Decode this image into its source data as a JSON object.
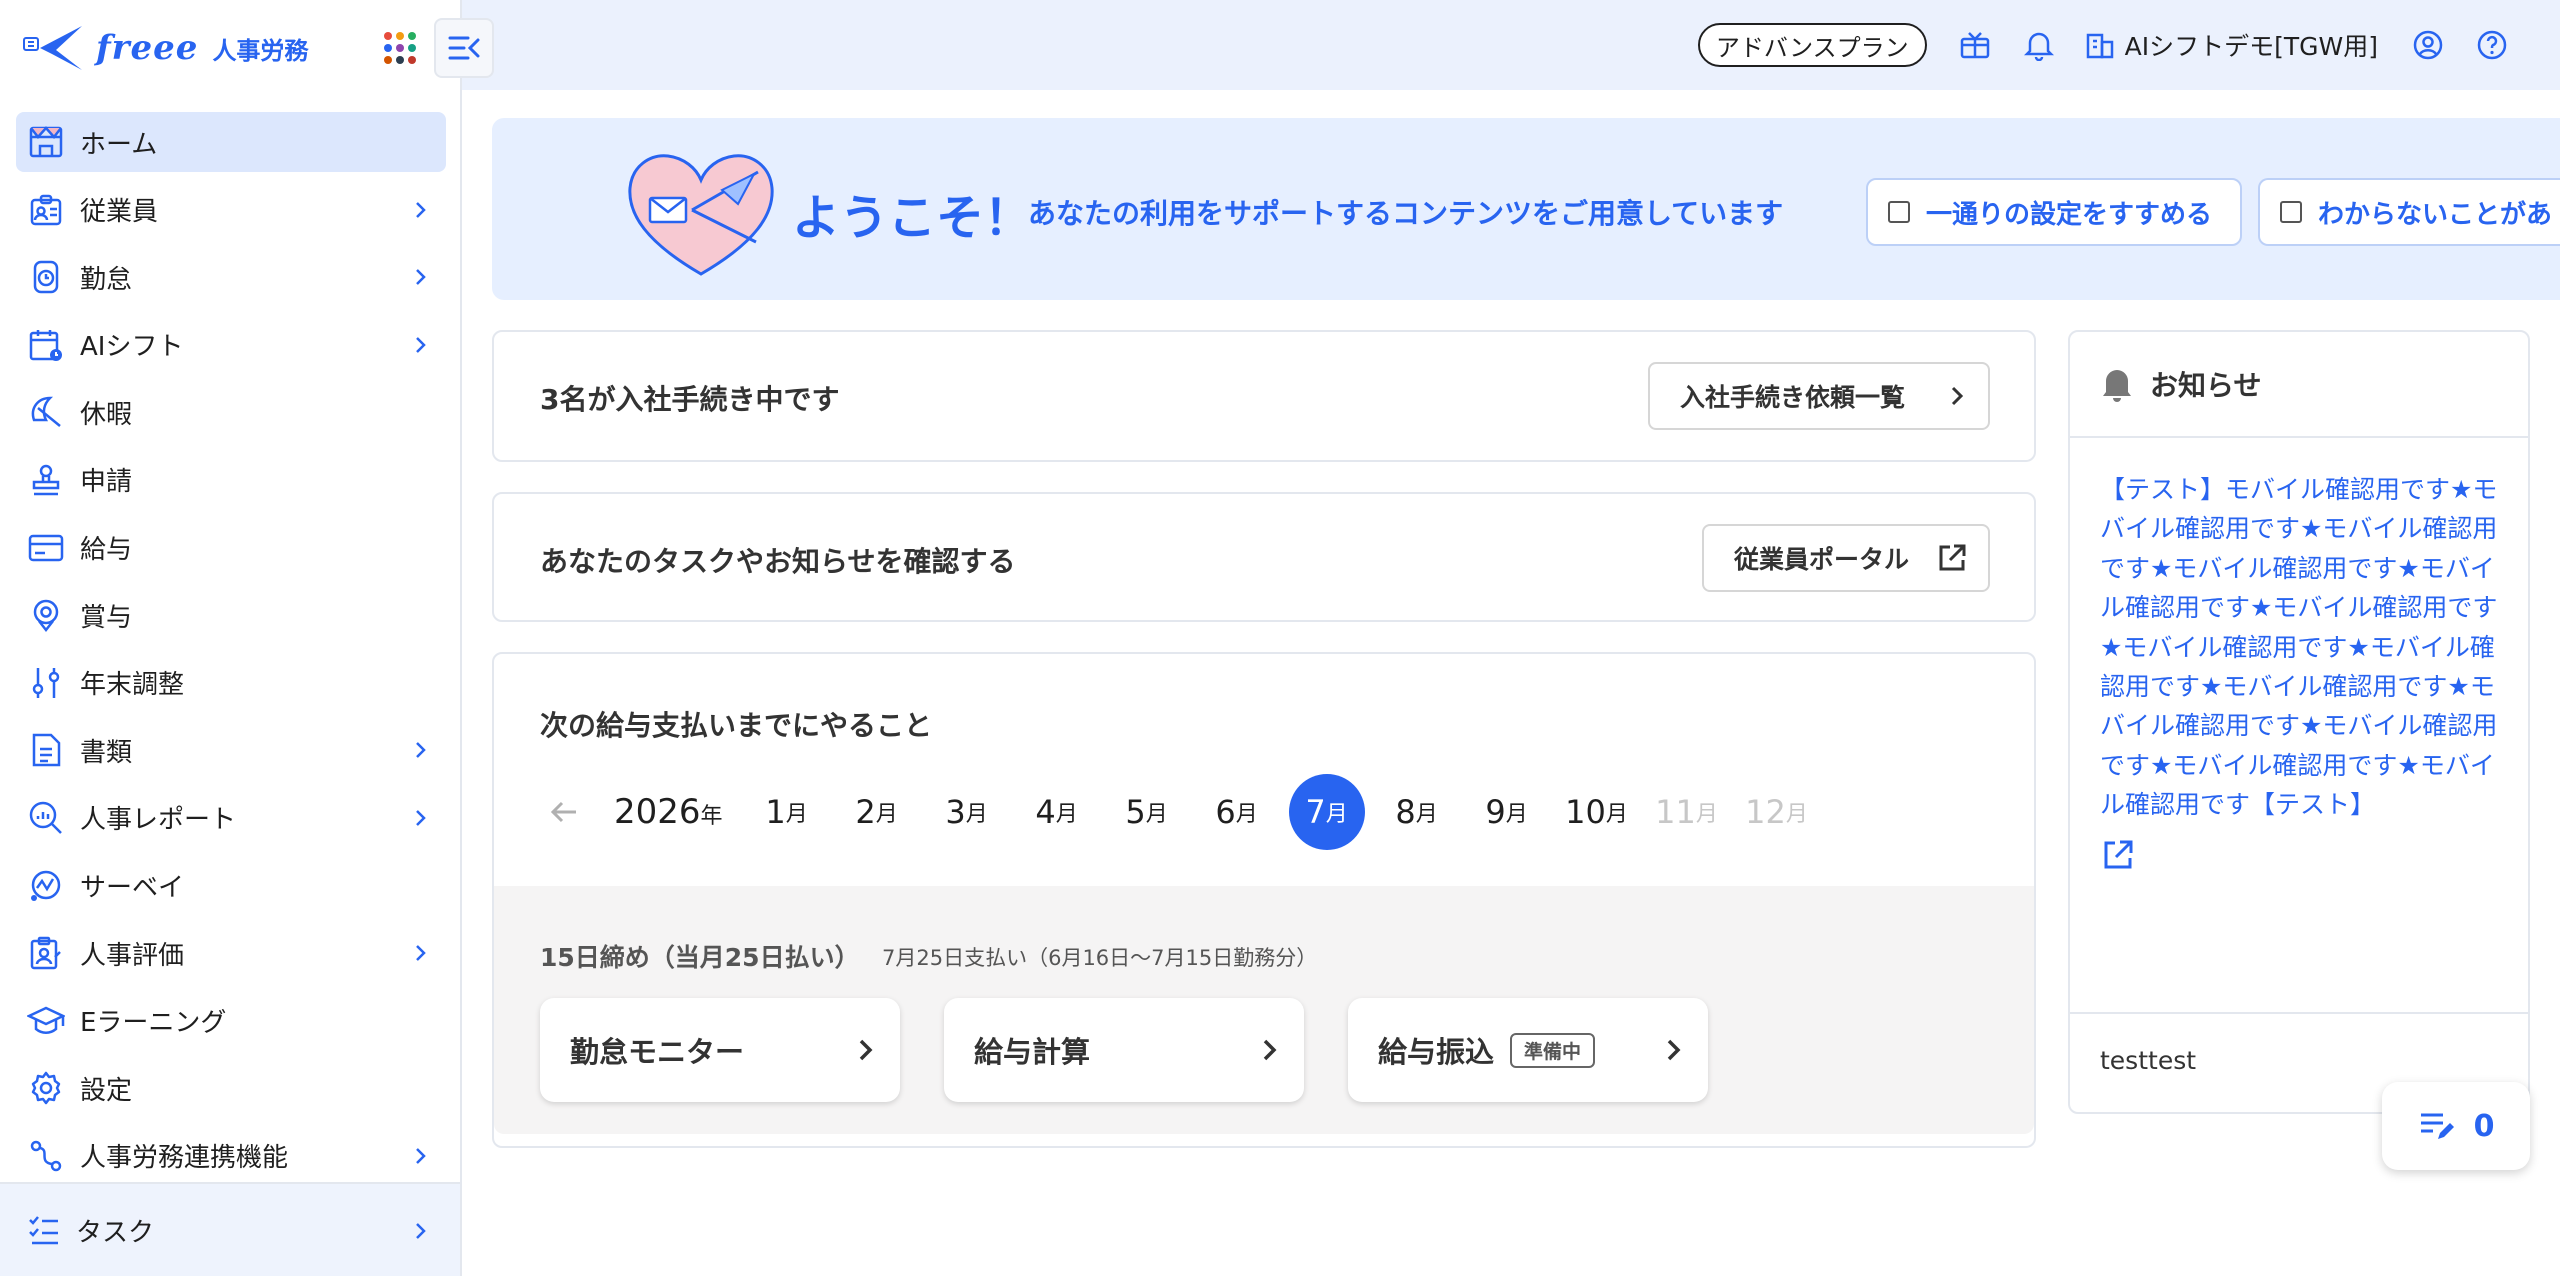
{
  "app": {
    "logo_text": "freee",
    "logo_sub": "人事労務"
  },
  "header": {
    "plan": "アドバンスプラン",
    "company": "AIシフトデモ[TGW用]"
  },
  "sidebar": {
    "items": [
      {
        "label": "ホーム",
        "icon": "home-icon",
        "active": true,
        "has_chevron": false
      },
      {
        "label": "従業員",
        "icon": "employee-icon",
        "has_chevron": true
      },
      {
        "label": "勤怠",
        "icon": "attendance-icon",
        "has_chevron": true
      },
      {
        "label": "AIシフト",
        "icon": "calendar-icon",
        "has_chevron": true
      },
      {
        "label": "休暇",
        "icon": "umbrella-icon",
        "has_chevron": false
      },
      {
        "label": "申請",
        "icon": "stamp-icon",
        "has_chevron": false
      },
      {
        "label": "給与",
        "icon": "card-icon",
        "has_chevron": false
      },
      {
        "label": "賞与",
        "icon": "medal-icon",
        "has_chevron": false
      },
      {
        "label": "年末調整",
        "icon": "sliders-icon",
        "has_chevron": false
      },
      {
        "label": "書類",
        "icon": "document-icon",
        "has_chevron": true
      },
      {
        "label": "人事レポート",
        "icon": "report-icon",
        "has_chevron": true
      },
      {
        "label": "サーベイ",
        "icon": "survey-icon",
        "has_chevron": false
      },
      {
        "label": "人事評価",
        "icon": "evaluation-icon",
        "has_chevron": true
      },
      {
        "label": "Eラーニング",
        "icon": "graduation-icon",
        "has_chevron": false
      },
      {
        "label": "設定",
        "icon": "gear-icon",
        "has_chevron": false
      },
      {
        "label": "人事労務連携機能",
        "icon": "link-icon",
        "has_chevron": true
      }
    ],
    "bottom": {
      "label": "タスク",
      "icon": "task-icon"
    }
  },
  "welcome": {
    "title": "ようこそ！",
    "message": "あなたの利用をサポートするコンテンツをご用意しています",
    "buttons": [
      "一通りの設定をすすめる",
      "わからないことがあ"
    ]
  },
  "onboarding": {
    "title": "3名が入社手続き中です",
    "button": "入社手続き依頼一覧"
  },
  "portal": {
    "title": "あなたのタスクやお知らせを確認する",
    "button": "従業員ポータル"
  },
  "payroll": {
    "title": "次の給与支払いまでにやること",
    "year": "2026",
    "year_unit": "年",
    "month_unit": "月",
    "months": [
      "1",
      "2",
      "3",
      "4",
      "5",
      "6",
      "7",
      "8",
      "9",
      "10",
      "11",
      "12"
    ],
    "selected_month": "7",
    "disabled_months": [
      "11",
      "12"
    ],
    "closing_title": "15日締め（当月25日払い）",
    "closing_sub": "7月25日支払い（6月16日〜7月15日勤務分）",
    "actions": [
      {
        "label": "勤怠モニター",
        "badge": ""
      },
      {
        "label": "給与計算",
        "badge": ""
      },
      {
        "label": "給与振込",
        "badge": "準備中"
      }
    ]
  },
  "news": {
    "title": "お知らせ",
    "link_text": "【テスト】モバイル確認用です★モバイル確認用です★モバイル確認用です★モバイル確認用です★モバイル確認用です★モバイル確認用です★モバイル確認用です★モバイル確認用です★モバイル確認用です★モバイル確認用です★モバイル確認用です★モバイル確認用です★モバイル確認用です【テスト】",
    "footer": "testtest"
  },
  "fab": {
    "count": "0"
  },
  "colors": {
    "accent": "#2864f0",
    "active_bg": "#dce7fd",
    "header_bg": "#ebf1fd"
  }
}
